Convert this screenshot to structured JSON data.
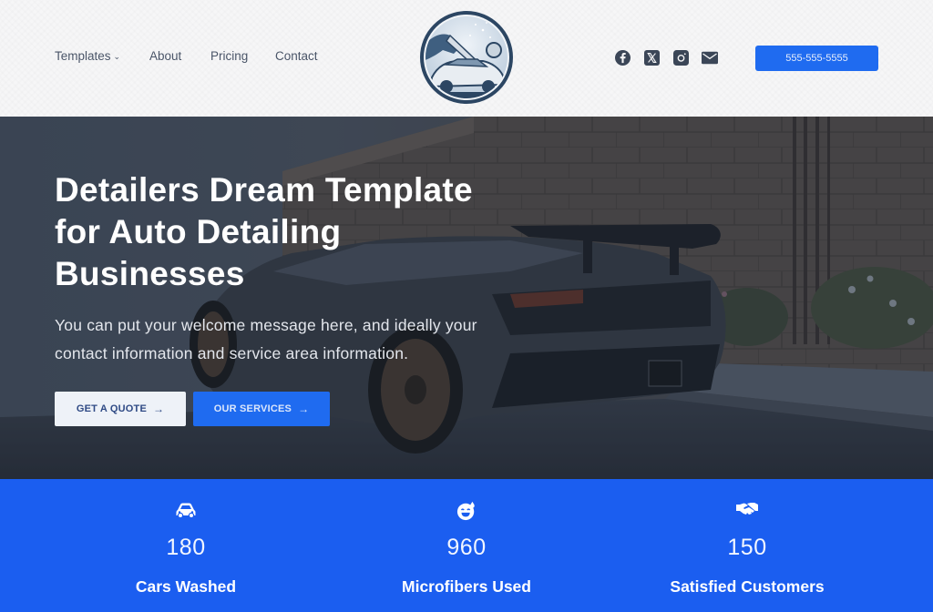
{
  "header": {
    "nav": [
      {
        "label": "Templates",
        "has_dropdown": true
      },
      {
        "label": "About"
      },
      {
        "label": "Pricing"
      },
      {
        "label": "Contact"
      }
    ],
    "logo_alt": "Car wash logo",
    "social": [
      {
        "name": "facebook-icon"
      },
      {
        "name": "x-icon"
      },
      {
        "name": "instagram-icon"
      },
      {
        "name": "email-icon"
      }
    ],
    "phone": "555-555-5555"
  },
  "hero": {
    "title_lines": [
      "Detailers Dream Template",
      "for Auto Detailing",
      "Businesses"
    ],
    "text_lines": [
      "You can put your welcome message here, and ideally your",
      "contact information and service area information."
    ],
    "buttons": {
      "quote": "GET A QUOTE",
      "services": "OUR SERVICES",
      "arrow": "→"
    }
  },
  "stats": [
    {
      "icon": "car-icon",
      "value": "180",
      "label": "Cars Washed"
    },
    {
      "icon": "smile-sweat-icon",
      "value": "960",
      "label": "Microfibers Used"
    },
    {
      "icon": "handshake-icon",
      "value": "150",
      "label": "Satisfied Customers"
    }
  ],
  "colors": {
    "accent": "#1f6bf0",
    "stats_bg": "#1b5ef0",
    "nav_text": "#4a5568"
  }
}
